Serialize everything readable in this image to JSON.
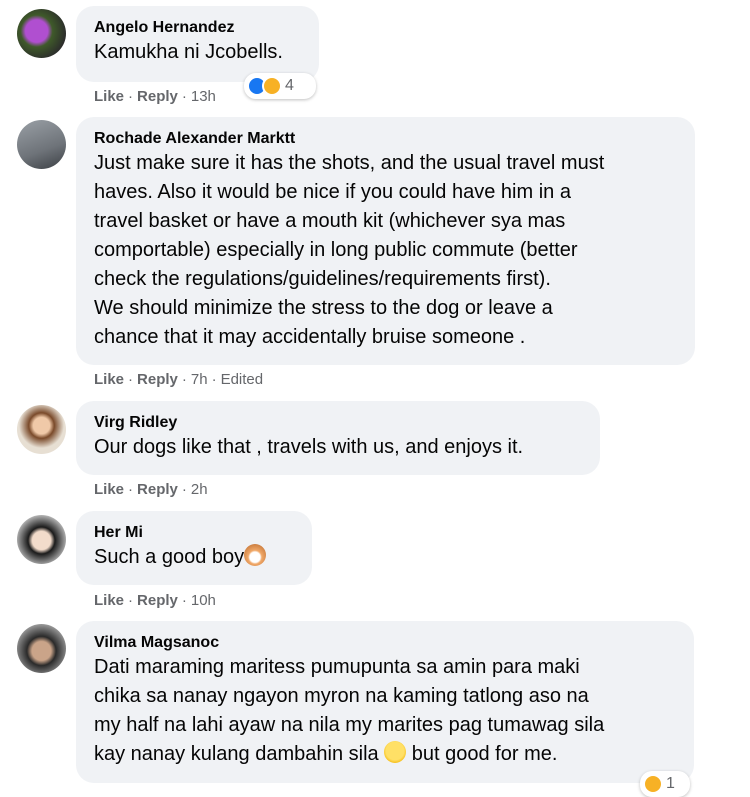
{
  "comments": [
    {
      "author": "Angelo Hernandez",
      "lines": [
        "Kamukha ni Jcobells."
      ],
      "actions": {
        "like": "Like",
        "reply": "Reply",
        "time": "13h"
      },
      "reactions": {
        "count": "4",
        "icons": [
          "like-icon",
          "care-icon"
        ]
      }
    },
    {
      "author": "Rochade Alexander Marktt",
      "lines": [
        "Just make sure it has the shots, and the usual travel must",
        "haves. Also it would be nice if you could have him in a",
        "travel basket or have a mouth kit (whichever sya mas",
        "comportable) especially in long public commute (better",
        "check the regulations/guidelines/requirements first).",
        "We should minimize the stress to the dog or leave a",
        "chance that it may accidentally bruise someone ."
      ],
      "actions": {
        "like": "Like",
        "reply": "Reply",
        "time": "7h",
        "edited": "Edited"
      }
    },
    {
      "author": "Virg Ridley",
      "lines": [
        "Our dogs like that , travels with us, and enjoys it."
      ],
      "actions": {
        "like": "Like",
        "reply": "Reply",
        "time": "2h"
      }
    },
    {
      "author": "Her Mi",
      "lines": [
        "Such a good boy"
      ],
      "inline_emoji": "dog-face-emoji",
      "actions": {
        "like": "Like",
        "reply": "Reply",
        "time": "10h"
      }
    },
    {
      "author": "Vilma Magsanoc",
      "lines": [
        "Dati maraming maritess pumupunta sa amin para maki",
        "chika sa nanay ngayon myron na kaming tatlong aso na",
        "my half na lahi ayaw na nila my marites pag tumawag sila"
      ],
      "last_line_before": "kay nanay kulang dambahin sila",
      "last_line_emoji": "grinning-sweat-emoji",
      "last_line_after": " but good for me.",
      "reactions": {
        "count": "1",
        "icons": [
          "haha-icon"
        ]
      }
    }
  ],
  "colors": {
    "bubble": "#f0f2f5",
    "meta_text": "#65676b",
    "like_blue": "#1877f2",
    "care_yellow": "#f7b125"
  }
}
